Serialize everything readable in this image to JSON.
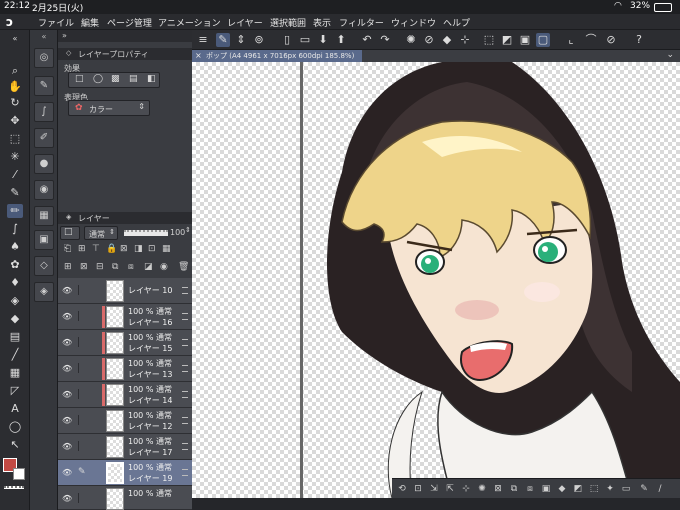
{
  "status": {
    "time": "22:12",
    "date": "2月25日(火)",
    "battery": "32%"
  },
  "menu": [
    "ファイル",
    "編集",
    "ページ管理",
    "アニメーション",
    "レイヤー",
    "選択範囲",
    "表示",
    "フィルター",
    "ウィンドウ",
    "ヘルプ"
  ],
  "layer_property": {
    "title": "レイヤープロパティ",
    "effect_label": "効果",
    "display_color_label": "表現色",
    "display_color_value": "カラー"
  },
  "layers_panel": {
    "title": "レイヤー",
    "blend_mode": "通常",
    "opacity": "100"
  },
  "layers": [
    {
      "line1": "レイヤー 10",
      "line2": "",
      "red_mark": false,
      "selected": false
    },
    {
      "line1": "100 % 通常",
      "line2": "レイヤー 16",
      "red_mark": true,
      "selected": false
    },
    {
      "line1": "100 % 通常",
      "line2": "レイヤー 15",
      "red_mark": true,
      "selected": false
    },
    {
      "line1": "100 % 通常",
      "line2": "レイヤー 13",
      "red_mark": true,
      "selected": false
    },
    {
      "line1": "100 % 通常",
      "line2": "レイヤー 14",
      "red_mark": true,
      "selected": false
    },
    {
      "line1": "100 % 通常",
      "line2": "レイヤー 12",
      "red_mark": false,
      "selected": false
    },
    {
      "line1": "100 % 通常",
      "line2": "レイヤー 17",
      "red_mark": false,
      "selected": false
    },
    {
      "line1": "100 % 通常",
      "line2": "レイヤー 19",
      "red_mark": false,
      "selected": true
    },
    {
      "line1": "100 % 通常",
      "line2": "",
      "red_mark": false,
      "selected": false
    }
  ],
  "document_tab": "ポップ (A4 4961 x 7016px 600dpi 185.8%)",
  "colors": {
    "accent": "#5a6a8c",
    "main_color": "#c24a44",
    "sub_color": "#ffffff"
  }
}
